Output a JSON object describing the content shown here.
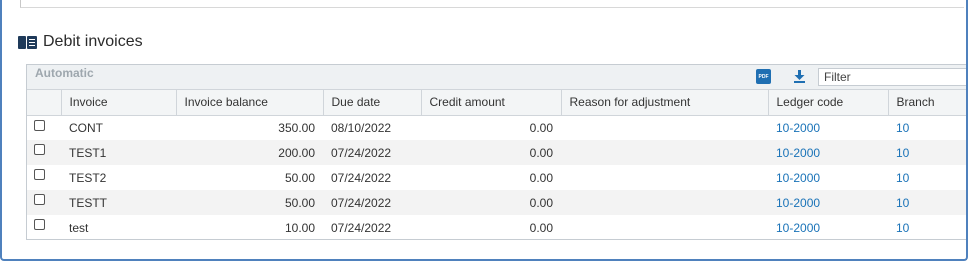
{
  "section": {
    "title": "Debit invoices",
    "icon": "book-icon"
  },
  "toolbar": {
    "label": "Automatic",
    "pdf_label": "PDF",
    "filter_placeholder": "Filter"
  },
  "columns": [
    "Invoice",
    "Invoice balance",
    "Due date",
    "Credit amount",
    "Reason for adjustment",
    "Ledger code",
    "Branch"
  ],
  "rows": [
    {
      "invoice": "CONT",
      "balance": "350.00",
      "due": "08/10/2022",
      "credit": "0.00",
      "reason": "",
      "ledger": "10-2000",
      "branch": "10"
    },
    {
      "invoice": "TEST1",
      "balance": "200.00",
      "due": "07/24/2022",
      "credit": "0.00",
      "reason": "",
      "ledger": "10-2000",
      "branch": "10"
    },
    {
      "invoice": "TEST2",
      "balance": "50.00",
      "due": "07/24/2022",
      "credit": "0.00",
      "reason": "",
      "ledger": "10-2000",
      "branch": "10"
    },
    {
      "invoice": "TESTT",
      "balance": "50.00",
      "due": "07/24/2022",
      "credit": "0.00",
      "reason": "",
      "ledger": "10-2000",
      "branch": "10"
    },
    {
      "invoice": "test",
      "balance": "10.00",
      "due": "07/24/2022",
      "credit": "0.00",
      "reason": "",
      "ledger": "10-2000",
      "branch": "10"
    }
  ],
  "colors": {
    "frame": "#4f81bd",
    "link": "#1a73b8",
    "toolbar_bg": "#eef1f3"
  }
}
